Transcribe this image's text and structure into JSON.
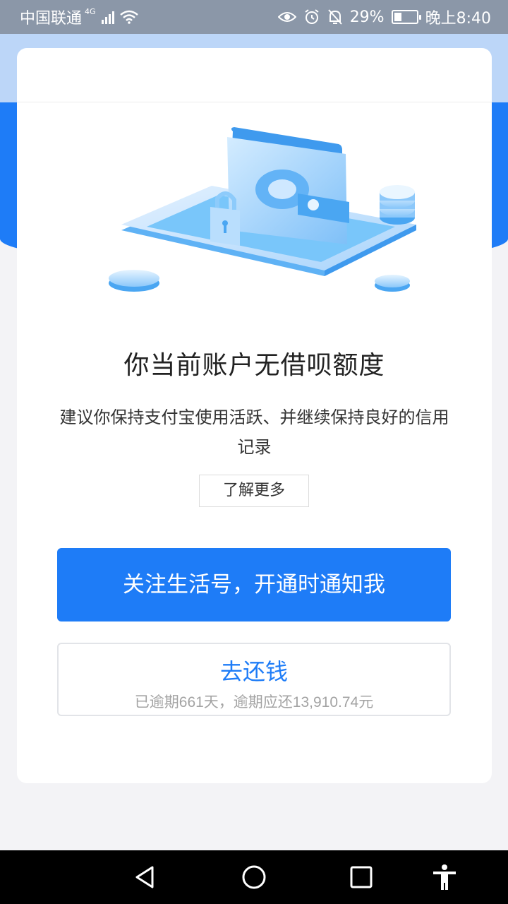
{
  "status_bar": {
    "carrier": "中国联通",
    "network": "4G",
    "battery_percent": "29%",
    "time": "晚上8:40",
    "icons": [
      "eye-icon",
      "alarm-icon",
      "mute-icon",
      "battery-icon"
    ]
  },
  "card": {
    "title": "你当前账户无借呗额度",
    "description": "建议你保持支付宝使用活跃、并继续保持良好的信用记录",
    "learn_more_label": "了解更多",
    "primary_button_label": "关注生活号，开通时通知我",
    "repay": {
      "title": "去还钱",
      "subtitle": "已逾期661天，逾期应还13,910.74元"
    }
  },
  "colors": {
    "accent": "#1e7cf7",
    "status_bar": "#8b97a8",
    "background": "#f3f3f6"
  },
  "nav_bar": {
    "icons": [
      "back-icon",
      "home-icon",
      "recents-icon",
      "accessibility-icon"
    ]
  }
}
